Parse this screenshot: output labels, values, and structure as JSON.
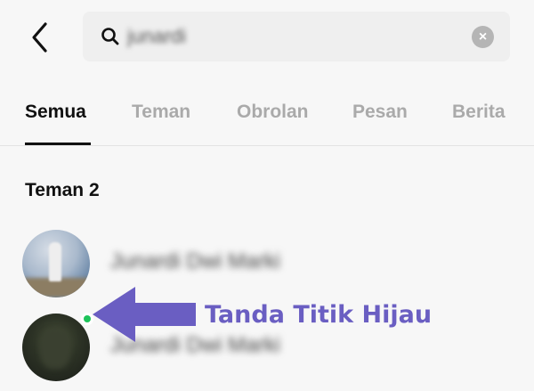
{
  "search": {
    "query": "junardi"
  },
  "tabs": [
    {
      "label": "Semua",
      "active": true
    },
    {
      "label": "Teman",
      "active": false
    },
    {
      "label": "Obrolan",
      "active": false
    },
    {
      "label": "Pesan",
      "active": false
    },
    {
      "label": "Berita",
      "active": false
    }
  ],
  "section": {
    "title": "Teman 2"
  },
  "contacts": [
    {
      "name": "Junardi Dwi Marki",
      "online": false
    },
    {
      "name": "Junardi Dwi Marki",
      "online": true
    }
  ],
  "annotation": {
    "text": "Tanda Titik Hijau",
    "color": "#6a5ec2"
  },
  "colors": {
    "online": "#1ec35a",
    "arrow": "#6a5ec2"
  },
  "icons": {
    "back": "chevron-left-icon",
    "search": "search-icon",
    "clear": "clear-icon"
  }
}
